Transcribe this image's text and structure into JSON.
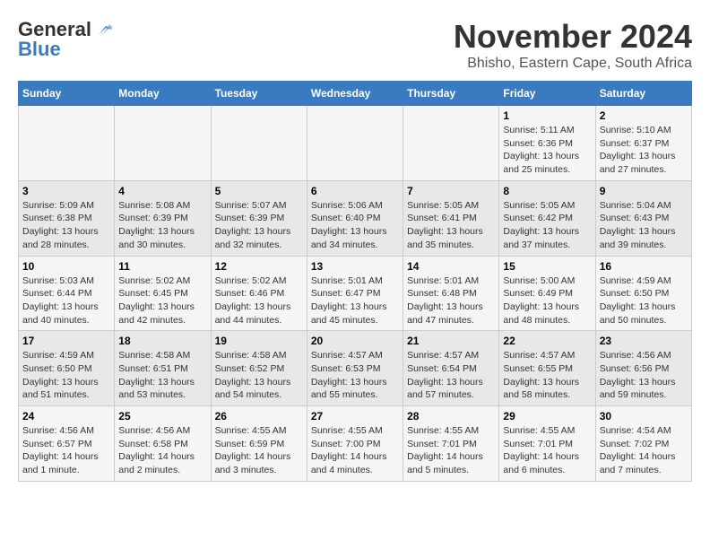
{
  "header": {
    "logo_line1": "General",
    "logo_line2": "Blue",
    "month_title": "November 2024",
    "subtitle": "Bhisho, Eastern Cape, South Africa"
  },
  "weekdays": [
    "Sunday",
    "Monday",
    "Tuesday",
    "Wednesday",
    "Thursday",
    "Friday",
    "Saturday"
  ],
  "weeks": [
    [
      {
        "day": "",
        "info": ""
      },
      {
        "day": "",
        "info": ""
      },
      {
        "day": "",
        "info": ""
      },
      {
        "day": "",
        "info": ""
      },
      {
        "day": "",
        "info": ""
      },
      {
        "day": "1",
        "info": "Sunrise: 5:11 AM\nSunset: 6:36 PM\nDaylight: 13 hours\nand 25 minutes."
      },
      {
        "day": "2",
        "info": "Sunrise: 5:10 AM\nSunset: 6:37 PM\nDaylight: 13 hours\nand 27 minutes."
      }
    ],
    [
      {
        "day": "3",
        "info": "Sunrise: 5:09 AM\nSunset: 6:38 PM\nDaylight: 13 hours\nand 28 minutes."
      },
      {
        "day": "4",
        "info": "Sunrise: 5:08 AM\nSunset: 6:39 PM\nDaylight: 13 hours\nand 30 minutes."
      },
      {
        "day": "5",
        "info": "Sunrise: 5:07 AM\nSunset: 6:39 PM\nDaylight: 13 hours\nand 32 minutes."
      },
      {
        "day": "6",
        "info": "Sunrise: 5:06 AM\nSunset: 6:40 PM\nDaylight: 13 hours\nand 34 minutes."
      },
      {
        "day": "7",
        "info": "Sunrise: 5:05 AM\nSunset: 6:41 PM\nDaylight: 13 hours\nand 35 minutes."
      },
      {
        "day": "8",
        "info": "Sunrise: 5:05 AM\nSunset: 6:42 PM\nDaylight: 13 hours\nand 37 minutes."
      },
      {
        "day": "9",
        "info": "Sunrise: 5:04 AM\nSunset: 6:43 PM\nDaylight: 13 hours\nand 39 minutes."
      }
    ],
    [
      {
        "day": "10",
        "info": "Sunrise: 5:03 AM\nSunset: 6:44 PM\nDaylight: 13 hours\nand 40 minutes."
      },
      {
        "day": "11",
        "info": "Sunrise: 5:02 AM\nSunset: 6:45 PM\nDaylight: 13 hours\nand 42 minutes."
      },
      {
        "day": "12",
        "info": "Sunrise: 5:02 AM\nSunset: 6:46 PM\nDaylight: 13 hours\nand 44 minutes."
      },
      {
        "day": "13",
        "info": "Sunrise: 5:01 AM\nSunset: 6:47 PM\nDaylight: 13 hours\nand 45 minutes."
      },
      {
        "day": "14",
        "info": "Sunrise: 5:01 AM\nSunset: 6:48 PM\nDaylight: 13 hours\nand 47 minutes."
      },
      {
        "day": "15",
        "info": "Sunrise: 5:00 AM\nSunset: 6:49 PM\nDaylight: 13 hours\nand 48 minutes."
      },
      {
        "day": "16",
        "info": "Sunrise: 4:59 AM\nSunset: 6:50 PM\nDaylight: 13 hours\nand 50 minutes."
      }
    ],
    [
      {
        "day": "17",
        "info": "Sunrise: 4:59 AM\nSunset: 6:50 PM\nDaylight: 13 hours\nand 51 minutes."
      },
      {
        "day": "18",
        "info": "Sunrise: 4:58 AM\nSunset: 6:51 PM\nDaylight: 13 hours\nand 53 minutes."
      },
      {
        "day": "19",
        "info": "Sunrise: 4:58 AM\nSunset: 6:52 PM\nDaylight: 13 hours\nand 54 minutes."
      },
      {
        "day": "20",
        "info": "Sunrise: 4:57 AM\nSunset: 6:53 PM\nDaylight: 13 hours\nand 55 minutes."
      },
      {
        "day": "21",
        "info": "Sunrise: 4:57 AM\nSunset: 6:54 PM\nDaylight: 13 hours\nand 57 minutes."
      },
      {
        "day": "22",
        "info": "Sunrise: 4:57 AM\nSunset: 6:55 PM\nDaylight: 13 hours\nand 58 minutes."
      },
      {
        "day": "23",
        "info": "Sunrise: 4:56 AM\nSunset: 6:56 PM\nDaylight: 13 hours\nand 59 minutes."
      }
    ],
    [
      {
        "day": "24",
        "info": "Sunrise: 4:56 AM\nSunset: 6:57 PM\nDaylight: 14 hours\nand 1 minute."
      },
      {
        "day": "25",
        "info": "Sunrise: 4:56 AM\nSunset: 6:58 PM\nDaylight: 14 hours\nand 2 minutes."
      },
      {
        "day": "26",
        "info": "Sunrise: 4:55 AM\nSunset: 6:59 PM\nDaylight: 14 hours\nand 3 minutes."
      },
      {
        "day": "27",
        "info": "Sunrise: 4:55 AM\nSunset: 7:00 PM\nDaylight: 14 hours\nand 4 minutes."
      },
      {
        "day": "28",
        "info": "Sunrise: 4:55 AM\nSunset: 7:01 PM\nDaylight: 14 hours\nand 5 minutes."
      },
      {
        "day": "29",
        "info": "Sunrise: 4:55 AM\nSunset: 7:01 PM\nDaylight: 14 hours\nand 6 minutes."
      },
      {
        "day": "30",
        "info": "Sunrise: 4:54 AM\nSunset: 7:02 PM\nDaylight: 14 hours\nand 7 minutes."
      }
    ]
  ]
}
